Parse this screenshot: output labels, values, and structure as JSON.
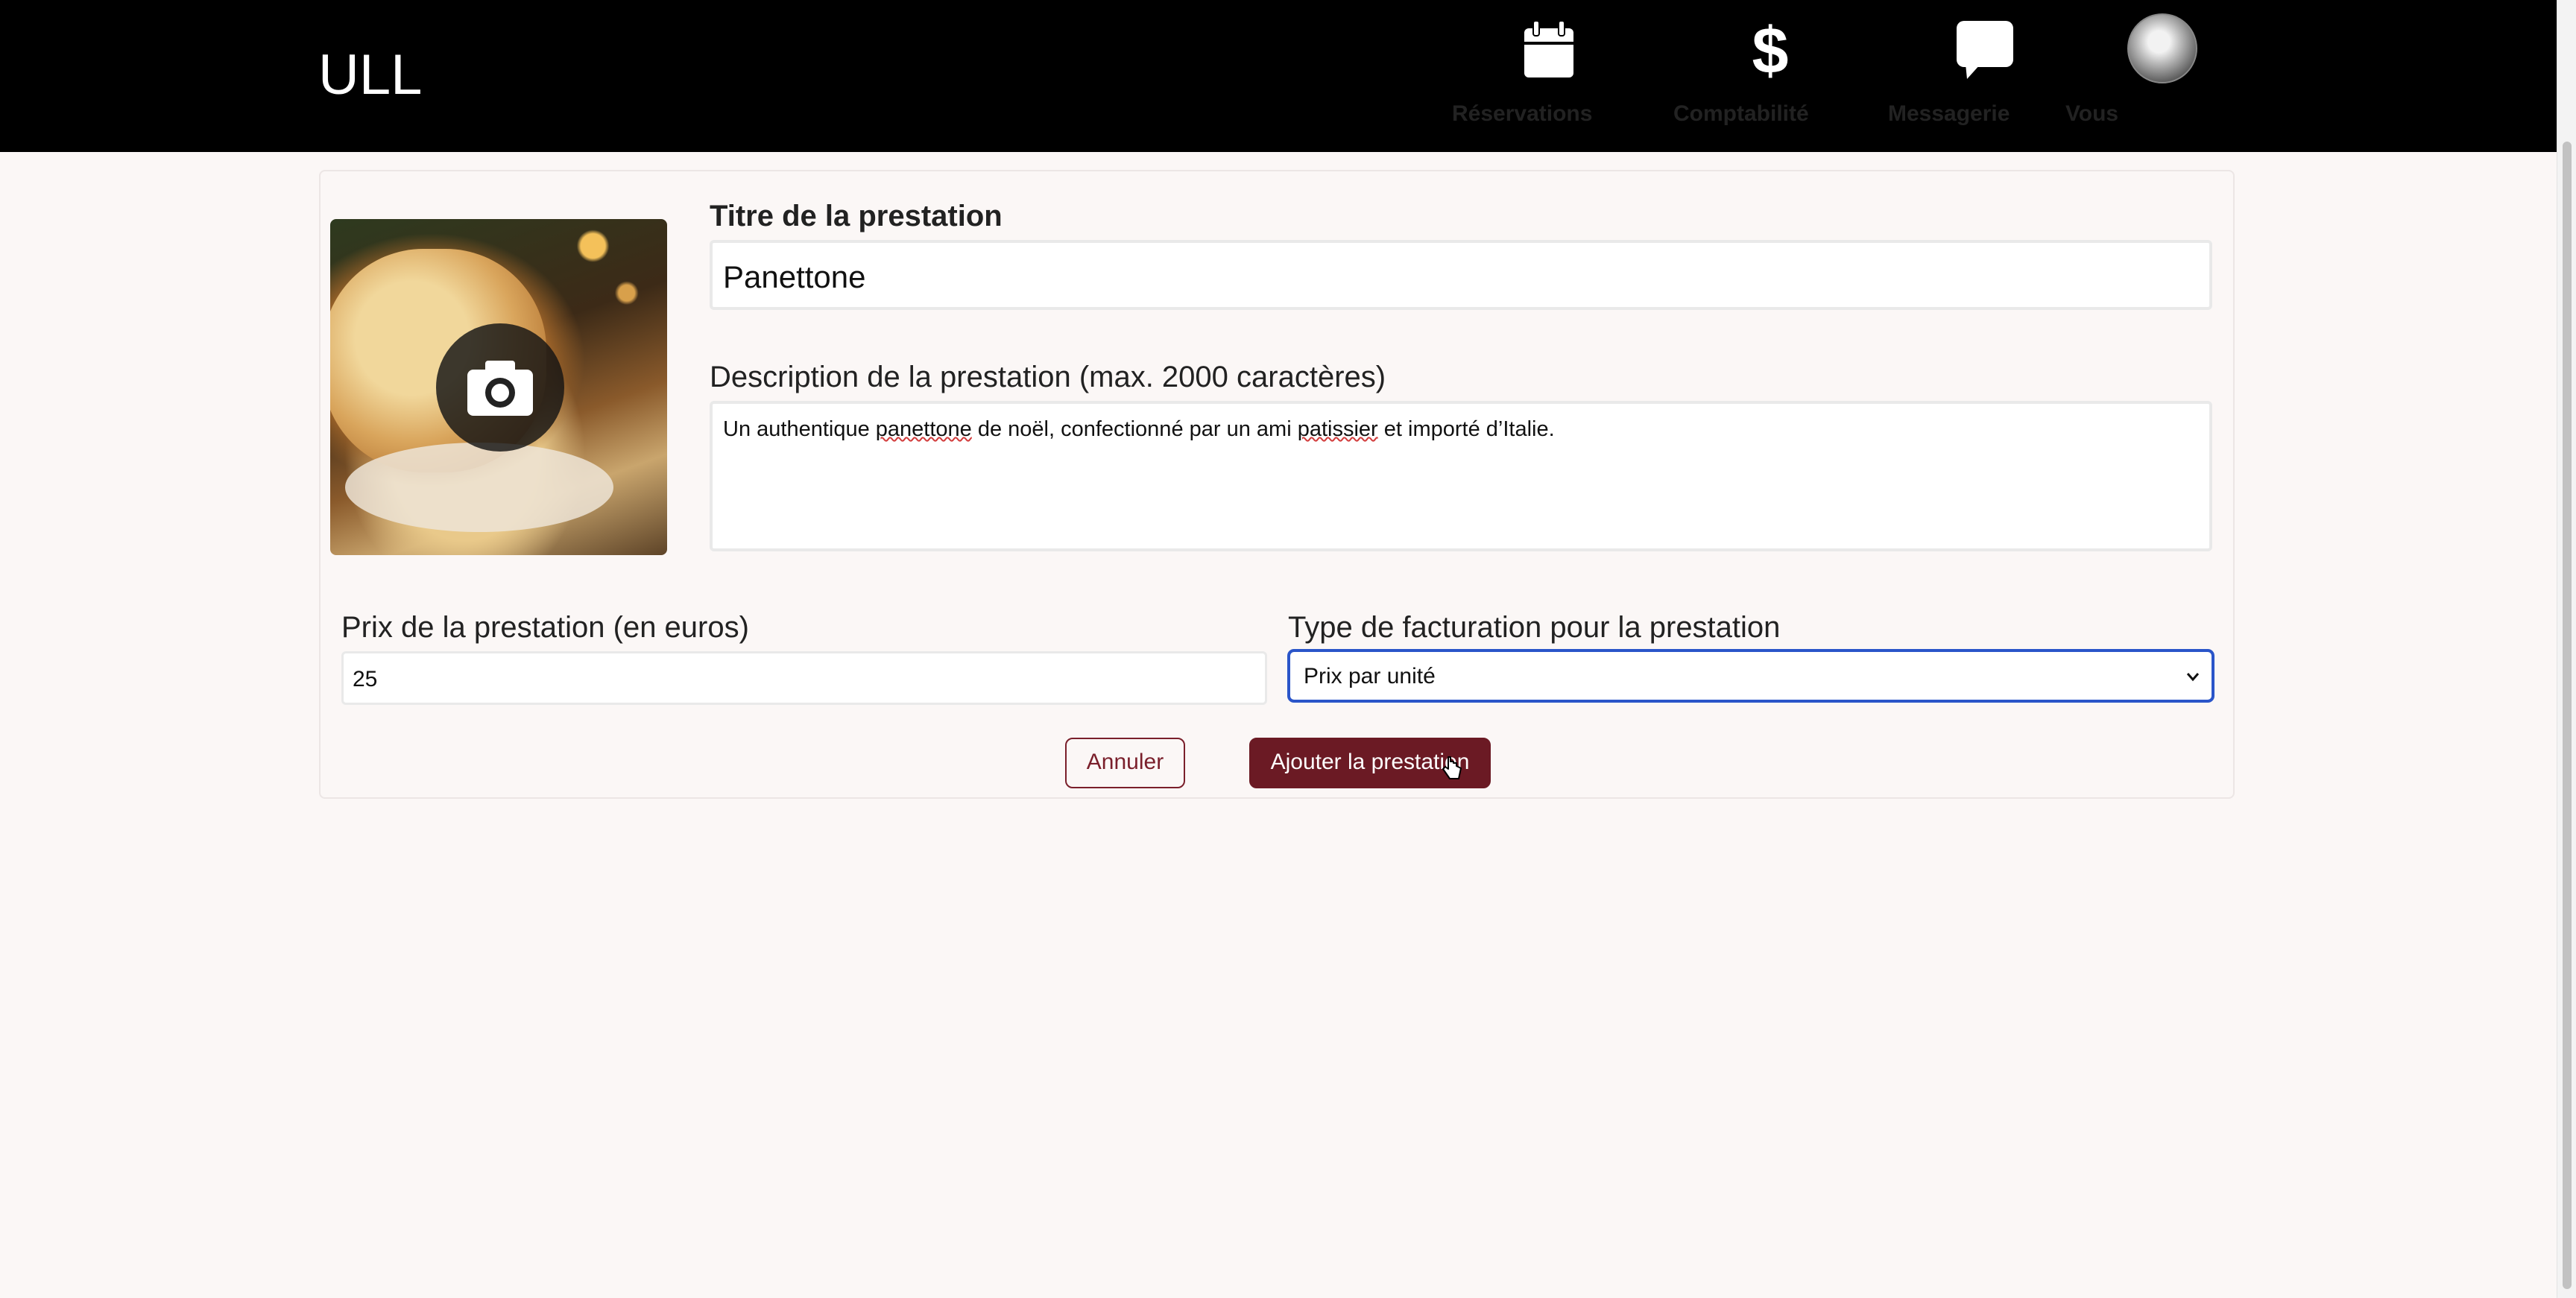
{
  "app": {
    "brand": "ULL"
  },
  "nav": {
    "items": [
      {
        "label": "Réservations",
        "icon": "calendar-icon"
      },
      {
        "label": "Comptabilité",
        "icon": "dollar-icon"
      },
      {
        "label": "Messagerie",
        "icon": "chat-bubble-icon"
      },
      {
        "label": "Vous",
        "icon": "avatar"
      }
    ]
  },
  "form": {
    "photo": {
      "icon": "camera-icon"
    },
    "title": {
      "label": "Titre de la prestation",
      "value": "Panettone"
    },
    "description": {
      "label": "Description de la prestation (max. 2000 caractères)",
      "value_parts": [
        "Un authentique ",
        "panettone",
        " de noël, confectionné par un ami ",
        "patissier",
        " et importé d’Italie."
      ]
    },
    "price": {
      "label": "Prix de la prestation (en euros)",
      "value": "25"
    },
    "billing": {
      "label": "Type de facturation pour la prestation",
      "selected": "Prix par unité"
    },
    "actions": {
      "cancel_label": "Annuler",
      "submit_label": "Ajouter la prestation"
    }
  },
  "colors": {
    "topbar": "#000000",
    "background": "#fbf7f6",
    "primary": "#6b1a24",
    "focus": "#2a55c9"
  }
}
